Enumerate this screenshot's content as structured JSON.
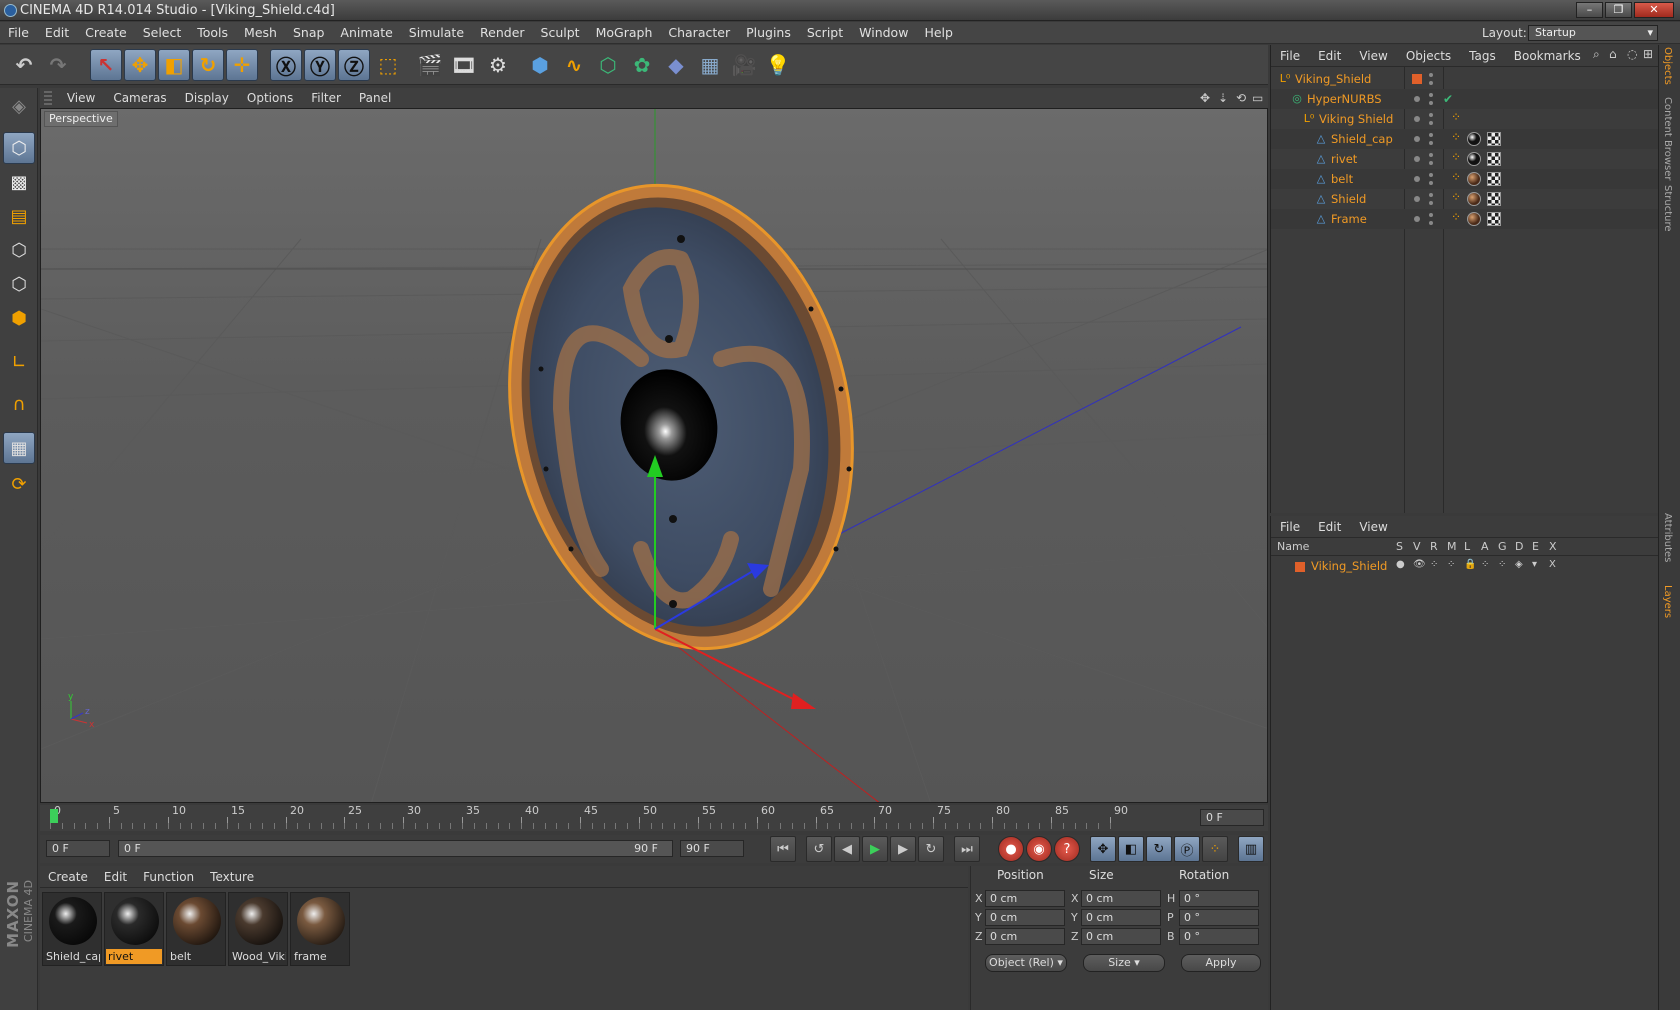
{
  "window": {
    "title": "CINEMA 4D R14.014 Studio - [Viking_Shield.c4d]"
  },
  "menubar": {
    "items": [
      "File",
      "Edit",
      "Create",
      "Select",
      "Tools",
      "Mesh",
      "Snap",
      "Animate",
      "Simulate",
      "Render",
      "Sculpt",
      "MoGraph",
      "Character",
      "Plugins",
      "Script",
      "Window",
      "Help"
    ],
    "layout_label": "Layout:",
    "layout_value": "Startup"
  },
  "viewport": {
    "menu": [
      "View",
      "Cameras",
      "Display",
      "Options",
      "Filter",
      "Panel"
    ],
    "camera_label": "Perspective"
  },
  "timeline": {
    "ticks": [
      "0",
      "5",
      "10",
      "15",
      "20",
      "25",
      "30",
      "35",
      "40",
      "45",
      "50",
      "55",
      "60",
      "65",
      "70",
      "75",
      "80",
      "85",
      "90"
    ],
    "current_frame": "0 F",
    "start_field": "0 F",
    "range_start": "0 F",
    "range_end": "90 F",
    "end_field": "90 F"
  },
  "materials": {
    "menu": [
      "Create",
      "Edit",
      "Function",
      "Texture"
    ],
    "items": [
      {
        "name": "Shield_cap",
        "color": "#1a1a1a"
      },
      {
        "name": "rivet",
        "color": "#2a2a2a"
      },
      {
        "name": "belt",
        "color": "#6b4a32"
      },
      {
        "name": "Wood_Viki",
        "color": "#4a3a2e"
      },
      {
        "name": "frame",
        "color": "#7a5a40"
      }
    ],
    "selected": "rivet"
  },
  "coordinates": {
    "headers": {
      "position": "Position",
      "size": "Size",
      "rotation": "Rotation"
    },
    "rows": [
      {
        "axis": "X",
        "pos": "0 cm",
        "size_axis": "X",
        "size": "0 cm",
        "rot_axis": "H",
        "rot": "0 °"
      },
      {
        "axis": "Y",
        "pos": "0 cm",
        "size_axis": "Y",
        "size": "0 cm",
        "rot_axis": "P",
        "rot": "0 °"
      },
      {
        "axis": "Z",
        "pos": "0 cm",
        "size_axis": "Z",
        "size": "0 cm",
        "rot_axis": "B",
        "rot": "0 °"
      }
    ],
    "mode": "Object (Rel)",
    "size_mode": "Size",
    "apply": "Apply"
  },
  "objects": {
    "menu": [
      "File",
      "Edit",
      "View",
      "Objects",
      "Tags",
      "Bookmarks"
    ],
    "tree": [
      {
        "name": "Viking_Shield",
        "indent": 0,
        "icon": "null-icon",
        "has_layer": true,
        "tags": []
      },
      {
        "name": "HyperNURBS",
        "indent": 1,
        "icon": "hypernurbs-icon",
        "has_layer": false,
        "tags": [
          "check"
        ]
      },
      {
        "name": "Viking Shield",
        "indent": 2,
        "icon": "null-icon",
        "has_layer": false,
        "tags": [
          "phong"
        ]
      },
      {
        "name": "Shield_cap",
        "indent": 3,
        "icon": "polygon-icon",
        "has_layer": false,
        "tags": [
          "phong",
          "mat-black",
          "uvw"
        ]
      },
      {
        "name": "rivet",
        "indent": 3,
        "icon": "polygon-icon",
        "has_layer": false,
        "tags": [
          "phong",
          "mat-black",
          "uvw"
        ]
      },
      {
        "name": "belt",
        "indent": 3,
        "icon": "polygon-icon",
        "has_layer": false,
        "tags": [
          "phong",
          "mat-brown",
          "uvw"
        ]
      },
      {
        "name": "Shield",
        "indent": 3,
        "icon": "polygon-icon",
        "has_layer": false,
        "tags": [
          "phong",
          "mat-brown",
          "uvw"
        ]
      },
      {
        "name": "Frame",
        "indent": 3,
        "icon": "polygon-icon",
        "has_layer": false,
        "tags": [
          "phong",
          "mat-brown",
          "uvw"
        ]
      }
    ]
  },
  "layers": {
    "menu": [
      "File",
      "Edit",
      "View"
    ],
    "columns": [
      "Name",
      "S",
      "V",
      "R",
      "M",
      "L",
      "A",
      "G",
      "D",
      "E",
      "X"
    ],
    "rows": [
      {
        "name": "Viking_Shield",
        "color": "#e0602a"
      }
    ]
  },
  "sidetabs": [
    "Objects",
    "Content Browser",
    "Structure",
    "Attributes",
    "Layers"
  ],
  "brand": {
    "maxon": "MAXON",
    "product": "CINEMA 4D"
  },
  "colors": {
    "accent": "#f09a25",
    "selection": "#f09a25"
  }
}
